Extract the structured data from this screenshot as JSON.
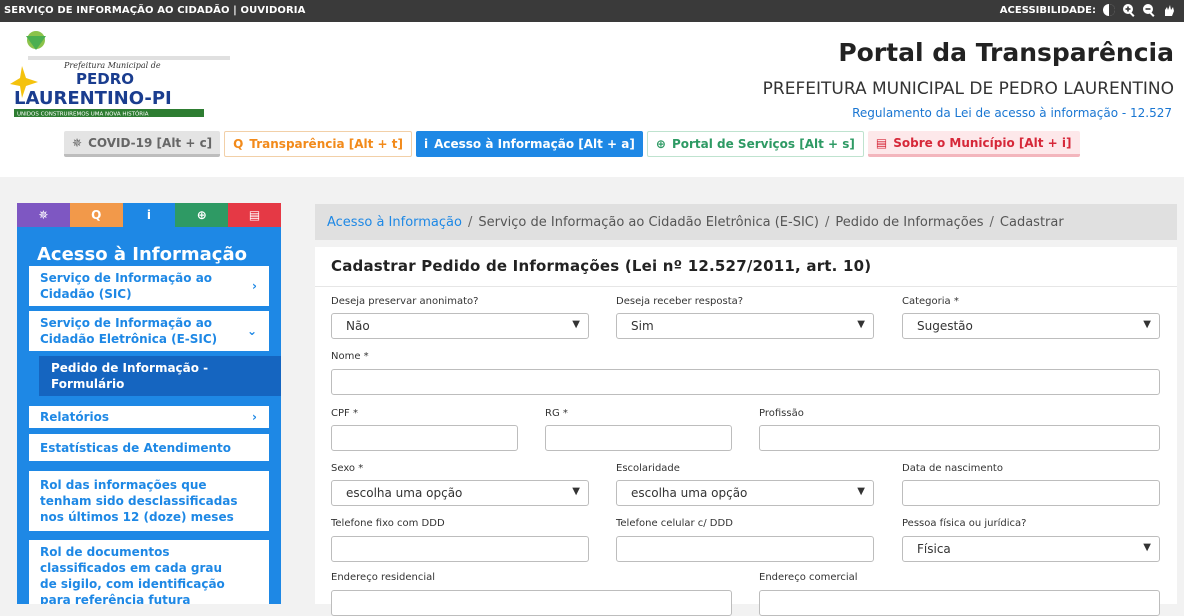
{
  "topbar": {
    "left_text": "SERVIÇO DE INFORMAÇÃO AO CIDADÃO | OUVIDORIA",
    "accessibility_label": "ACESSIBILIDADE:"
  },
  "logo": {
    "line1": "Prefeitura Municipal de",
    "line2": "PEDRO",
    "line3": "LAURENTINO-PI",
    "tagline": "UNIDOS CONSTRUIREMOS UMA NOVA HISTÓRIA"
  },
  "header": {
    "title": "Portal da Transparência",
    "subtitle": "PREFEITURA MUNICIPAL DE PEDRO LAURENTINO",
    "link": "Regulamento da Lei de acesso à informação - 12.527"
  },
  "menu": [
    {
      "label": "COVID-19 [Alt + c]",
      "icon": "virus-icon"
    },
    {
      "label": "Transparência [Alt + t]",
      "icon": "search-icon"
    },
    {
      "label": "Acesso à Informação [Alt + a]",
      "icon": "info-icon"
    },
    {
      "label": "Portal de Serviços [Alt + s]",
      "icon": "globe-icon"
    },
    {
      "label": "Sobre o Município [Alt + i]",
      "icon": "card-icon"
    }
  ],
  "sidebar": {
    "title": "Acesso à Informação",
    "tab_colors": [
      "#7e57c2",
      "#f2994a",
      "#1e88e5",
      "#2e9a64",
      "#e53945"
    ],
    "items": [
      {
        "label": "Serviço de Informação ao Cidadão (SIC)",
        "chevron": "›"
      },
      {
        "label": "Serviço de Informação ao Cidadão Eletrônica (E-SIC)",
        "chevron": "⌄"
      },
      {
        "label": "Pedido de Informação - Formulário"
      },
      {
        "label": "Relatórios",
        "chevron": "›"
      },
      {
        "label": "Estatísticas de Atendimento"
      },
      {
        "label": "Rol das informações que tenham sido desclassificadas nos últimos 12 (doze) meses"
      },
      {
        "label": "Rol de documentos classificados em cada grau de sigilo, com identificação para referência futura"
      }
    ]
  },
  "breadcrumb": {
    "link": "Acesso à Informação",
    "items": [
      "Serviço de Informação ao Cidadão Eletrônica (E-SIC)",
      "Pedido de Informações",
      "Cadastrar"
    ]
  },
  "form": {
    "title": "Cadastrar Pedido de Informações (Lei nº 12.527/2011, art. 10)",
    "anonimato": {
      "label": "Deseja preservar anonimato?",
      "value": "Não"
    },
    "resposta": {
      "label": "Deseja receber resposta?",
      "value": "Sim"
    },
    "categoria": {
      "label": "Categoria *",
      "value": "Sugestão"
    },
    "nome": {
      "label": "Nome *",
      "value": ""
    },
    "cpf": {
      "label": "CPF *",
      "value": ""
    },
    "rg": {
      "label": "RG *",
      "value": ""
    },
    "profissao": {
      "label": "Profissão",
      "value": ""
    },
    "sexo": {
      "label": "Sexo *",
      "value": "escolha uma opção"
    },
    "escolaridade": {
      "label": "Escolaridade",
      "value": "escolha uma opção"
    },
    "nascimento": {
      "label": "Data de nascimento",
      "value": ""
    },
    "tel_fixo": {
      "label": "Telefone fixo com DDD",
      "value": ""
    },
    "tel_celular": {
      "label": "Telefone celular c/ DDD",
      "value": ""
    },
    "pessoa": {
      "label": "Pessoa física ou jurídica?",
      "value": "Física"
    },
    "end_residencial": {
      "label": "Endereço residencial",
      "value": ""
    },
    "end_comercial": {
      "label": "Endereço comercial",
      "value": ""
    }
  }
}
